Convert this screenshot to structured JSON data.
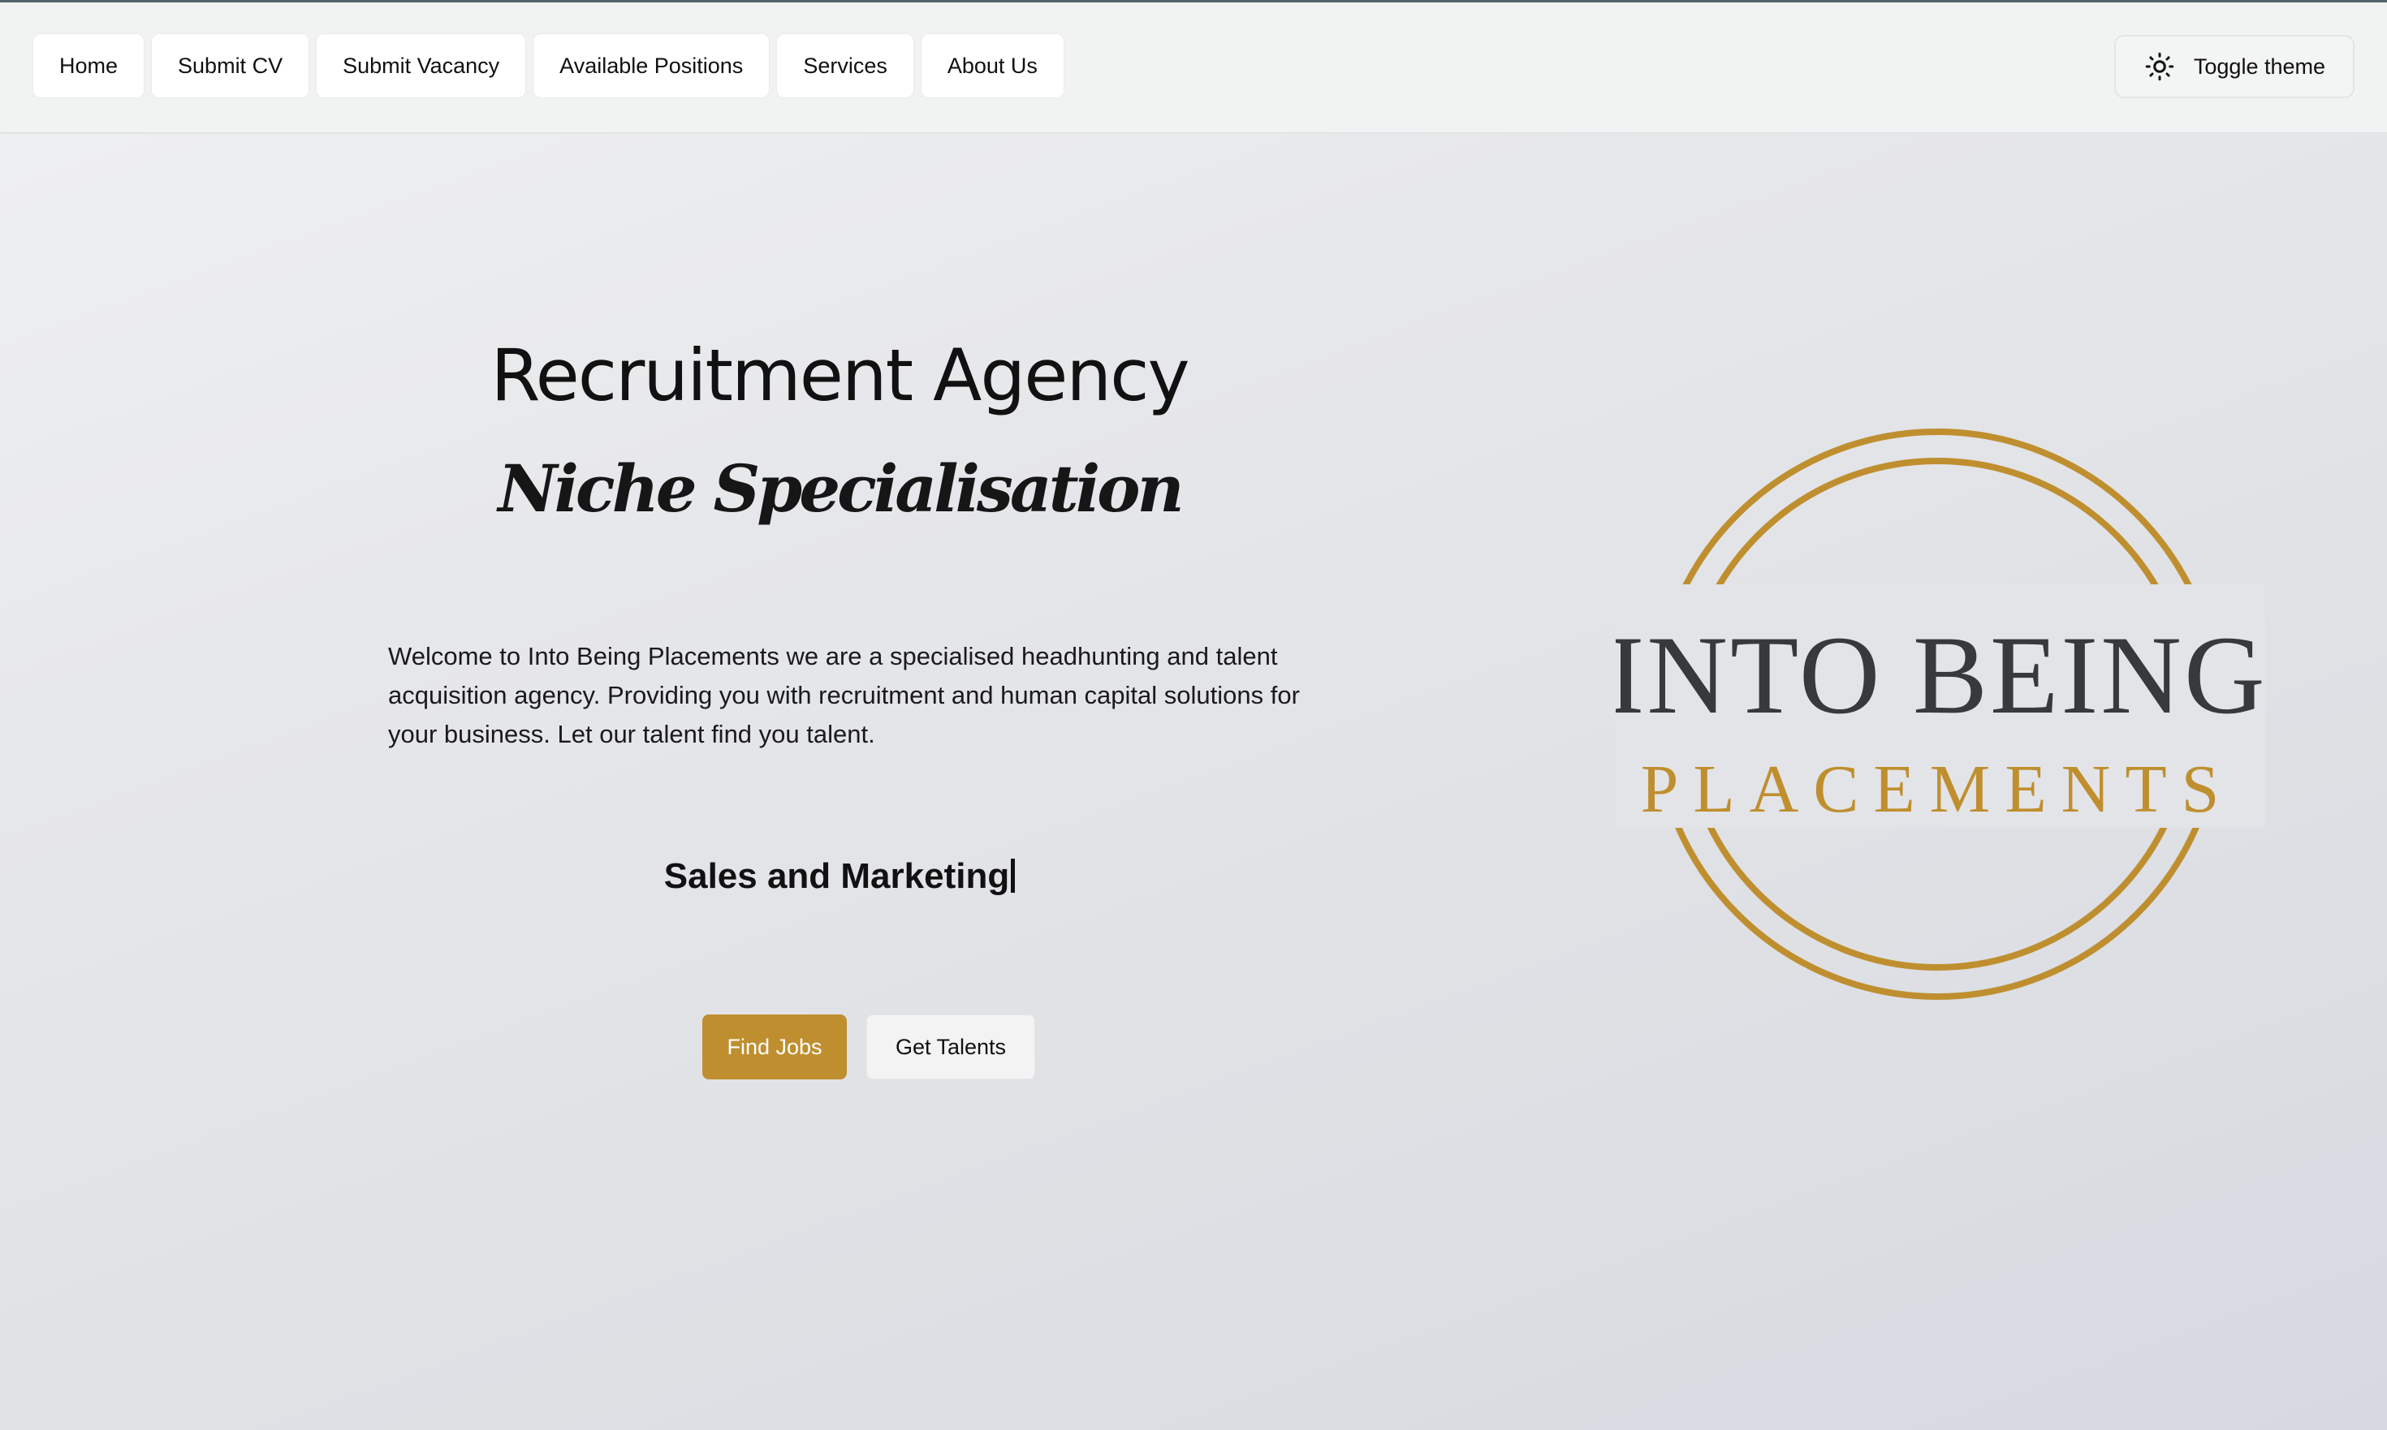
{
  "nav": {
    "items": [
      {
        "label": "Home"
      },
      {
        "label": "Submit CV"
      },
      {
        "label": "Submit Vacancy"
      },
      {
        "label": "Available Positions"
      },
      {
        "label": "Services"
      },
      {
        "label": "About Us"
      }
    ],
    "theme_toggle": {
      "label": "Toggle theme",
      "icon": "sun-icon"
    }
  },
  "hero": {
    "title": "Recruitment Agency",
    "subtitle": "Niche Specialisation",
    "description": "Welcome to Into Being Placements we are a specialised headhunting and talent acquisition agency. Providing you with recruitment and human capital solutions for your business. Let our talent find you talent.",
    "typed_text": "Sales and Marketing",
    "buttons": {
      "primary": "Find Jobs",
      "secondary": "Get Talents"
    }
  },
  "logo": {
    "line1": "INTO BEING",
    "line2": "PLACEMENTS",
    "colors": {
      "ring": "#bf8f2f",
      "text_dark": "#373a3c",
      "text_gold": "#bf8f2f"
    }
  },
  "colors": {
    "accent": "#bf8f2f",
    "top_rule": "#55646a"
  }
}
